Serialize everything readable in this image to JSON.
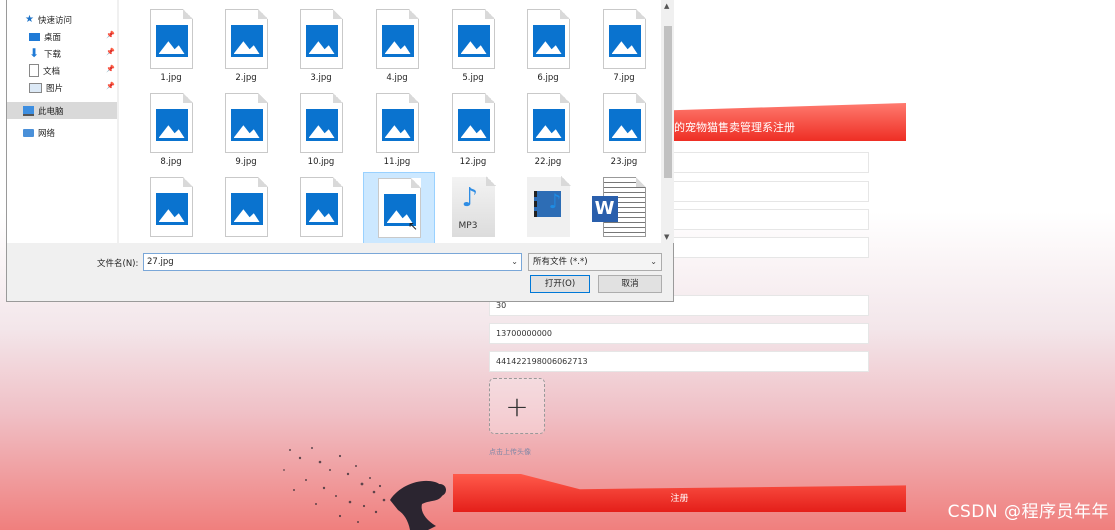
{
  "dialog": {
    "nav": {
      "quick_access": "快速访问",
      "items": [
        {
          "label": "桌面"
        },
        {
          "label": "下载"
        },
        {
          "label": "文档"
        },
        {
          "label": "图片"
        }
      ],
      "this_pc": "此电脑",
      "network": "网络"
    },
    "files": [
      {
        "name": "1.jpg"
      },
      {
        "name": "2.jpg"
      },
      {
        "name": "3.jpg"
      },
      {
        "name": "4.jpg"
      },
      {
        "name": "5.jpg"
      },
      {
        "name": "6.jpg"
      },
      {
        "name": "7.jpg"
      },
      {
        "name": "8.jpg"
      },
      {
        "name": "9.jpg"
      },
      {
        "name": "10.jpg"
      },
      {
        "name": "11.jpg"
      },
      {
        "name": "12.jpg"
      },
      {
        "name": "22.jpg"
      },
      {
        "name": "23.jpg"
      }
    ],
    "mp3_label": "MP3",
    "filename_label": "文件名(N):",
    "filename_value": "27.jpg",
    "filetype_value": "所有文件 (*.*)",
    "open_button": "打开(O)",
    "cancel_button": "取消"
  },
  "form": {
    "banner_title": "的宠物猫售卖管理系注册",
    "age_value": "30",
    "phone_value": "13700000000",
    "id_value": "441422198006062713",
    "upload_hint": "点击上传头像",
    "submit_label": "注册"
  },
  "watermark": "CSDN @程序员年年",
  "colors": {
    "accent_red": "#ee2e24",
    "selection_blue": "#cce8ff",
    "image_icon_blue": "#0a73cf"
  }
}
